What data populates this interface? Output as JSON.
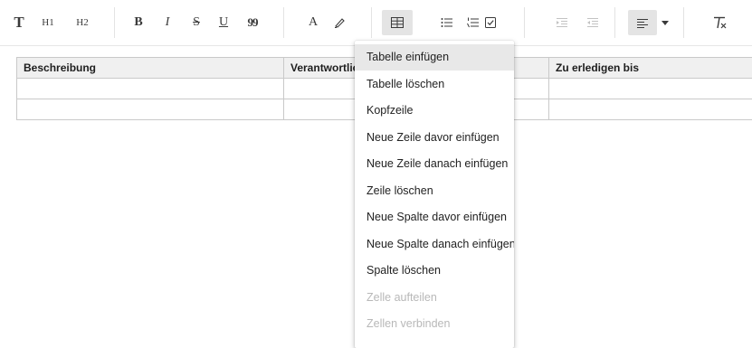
{
  "toolbar": {
    "paragraph_label": "T",
    "h1_label": "H1",
    "h2_label": "H2",
    "bold_label": "B",
    "italic_label": "I",
    "strike_label": "S",
    "underline_label": "U",
    "quote_label": "99",
    "text_color_label": "A",
    "highlight_icon": "marker-icon",
    "table_icon": "table-icon",
    "bullet_list_icon": "bullet-list-icon",
    "ordered_list_icon": "ordered-list-icon",
    "checklist_icon": "checklist-icon",
    "indent_icon": "indent-icon",
    "outdent_icon": "outdent-icon",
    "align_icon": "align-left-icon",
    "clear_format_icon": "clear-format-icon"
  },
  "table": {
    "headers": [
      "Beschreibung",
      "Verantwortlich",
      "",
      "Zu erledigen bis"
    ],
    "rows": [
      [
        "",
        "",
        "",
        ""
      ],
      [
        "",
        "",
        "",
        ""
      ]
    ]
  },
  "context_menu": {
    "items": [
      {
        "label": "Tabelle einfügen",
        "state": "hover"
      },
      {
        "label": "Tabelle löschen",
        "state": "enabled"
      },
      {
        "label": "Kopfzeile",
        "state": "enabled"
      },
      {
        "label": "Neue Zeile davor einfügen",
        "state": "enabled"
      },
      {
        "label": "Neue Zeile danach einfügen",
        "state": "enabled"
      },
      {
        "label": "Zeile löschen",
        "state": "enabled"
      },
      {
        "label": "Neue Spalte davor einfügen",
        "state": "enabled"
      },
      {
        "label": "Neue Spalte danach einfügen",
        "state": "enabled"
      },
      {
        "label": "Spalte löschen",
        "state": "enabled"
      },
      {
        "label": "Zelle aufteilen",
        "state": "disabled"
      },
      {
        "label": "Zellen verbinden",
        "state": "disabled"
      }
    ]
  }
}
